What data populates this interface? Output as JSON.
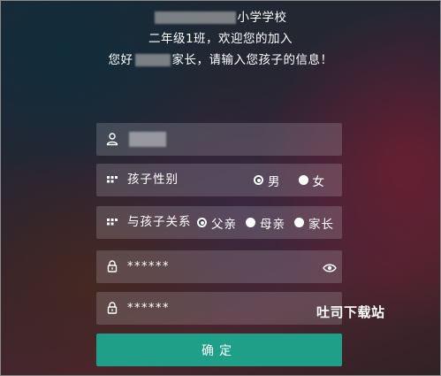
{
  "header": {
    "school_suffix": "小学学校",
    "welcome_line": "二年级1班，欢迎您的加入",
    "greeting_prefix": "您好",
    "greeting_suffix": "家长，请输入您孩子的信息！"
  },
  "form": {
    "name_field": {
      "icon": "user-icon"
    },
    "gender": {
      "icon": "grid-icon",
      "label": "孩子性别",
      "options": [
        {
          "label": "男",
          "selected": true
        },
        {
          "label": "女",
          "selected": false
        }
      ]
    },
    "relation": {
      "icon": "grid-icon",
      "label": "与孩子关系",
      "options": [
        {
          "label": "父亲",
          "selected": true
        },
        {
          "label": "母亲",
          "selected": false
        },
        {
          "label": "家长",
          "selected": false
        }
      ]
    },
    "password": {
      "icon": "lock-icon",
      "value": "******",
      "toggle_icon": "eye-icon"
    },
    "password_confirm": {
      "icon": "lock-icon",
      "value": "******"
    }
  },
  "confirm_label": "确定",
  "watermark": "吐司下载站",
  "colors": {
    "accent": "#1f9e88",
    "field_bg": "rgba(235,235,240,0.18)",
    "text": "#ffffff"
  }
}
